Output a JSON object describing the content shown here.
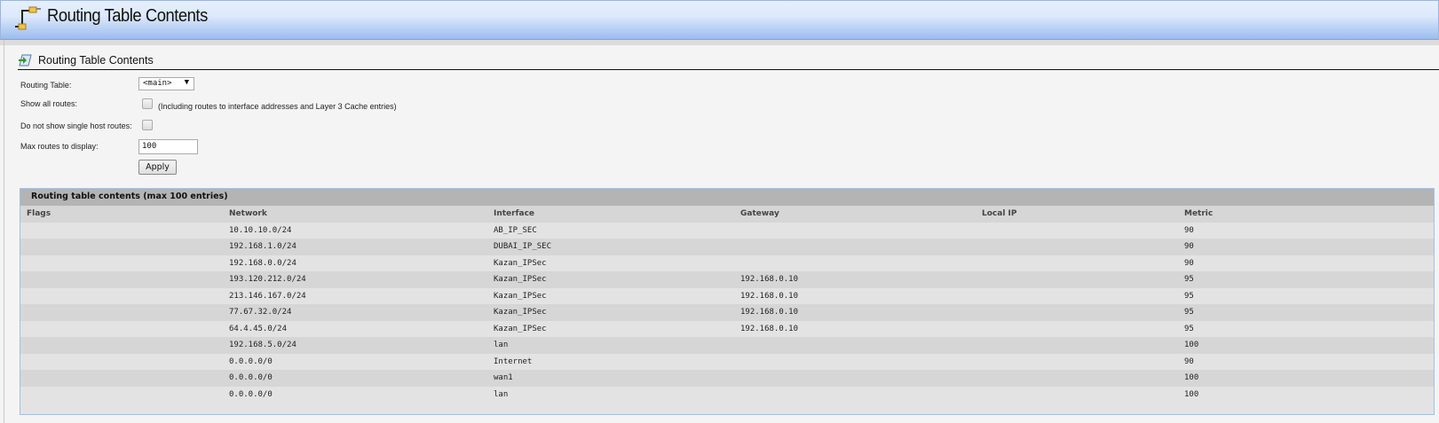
{
  "header": {
    "title": "Routing Table Contents",
    "icon": "routing-icon"
  },
  "section": {
    "title": "Routing Table Contents",
    "icon": "arrow-page-icon"
  },
  "form": {
    "routing_table_label": "Routing Table:",
    "routing_table_value": "<main>",
    "routing_table_arrow": "▼",
    "show_all_label": "Show all routes:",
    "show_all_checked": false,
    "show_all_note": "(Including routes to interface addresses and Layer 3 Cache entries)",
    "no_single_host_label": "Do not show single host routes:",
    "no_single_host_checked": false,
    "max_routes_label": "Max routes to display:",
    "max_routes_value": "100",
    "apply_label": "Apply"
  },
  "table": {
    "caption": "Routing table contents (max 100 entries)",
    "columns": [
      "Flags",
      "Network",
      "Interface",
      "Gateway",
      "Local IP",
      "Metric"
    ],
    "rows": [
      [
        "",
        "10.10.10.0/24",
        "AB_IP_SEC",
        "",
        "",
        "90"
      ],
      [
        "",
        "192.168.1.0/24",
        "DUBAI_IP_SEC",
        "",
        "",
        "90"
      ],
      [
        "",
        "192.168.0.0/24",
        "Kazan_IPSec",
        "",
        "",
        "90"
      ],
      [
        "",
        "193.120.212.0/24",
        "Kazan_IPSec",
        "192.168.0.10",
        "",
        "95"
      ],
      [
        "",
        "213.146.167.0/24",
        "Kazan_IPSec",
        "192.168.0.10",
        "",
        "95"
      ],
      [
        "",
        "77.67.32.0/24",
        "Kazan_IPSec",
        "192.168.0.10",
        "",
        "95"
      ],
      [
        "",
        "64.4.45.0/24",
        "Kazan_IPSec",
        "192.168.0.10",
        "",
        "95"
      ],
      [
        "",
        "192.168.5.0/24",
        "lan",
        "",
        "",
        "100"
      ],
      [
        "",
        "0.0.0.0/0",
        "Internet",
        "",
        "",
        "90"
      ],
      [
        "",
        "0.0.0.0/0",
        "wan1",
        "",
        "",
        "100"
      ],
      [
        "",
        "0.0.0.0/0",
        "lan",
        "",
        "",
        "100"
      ]
    ]
  }
}
